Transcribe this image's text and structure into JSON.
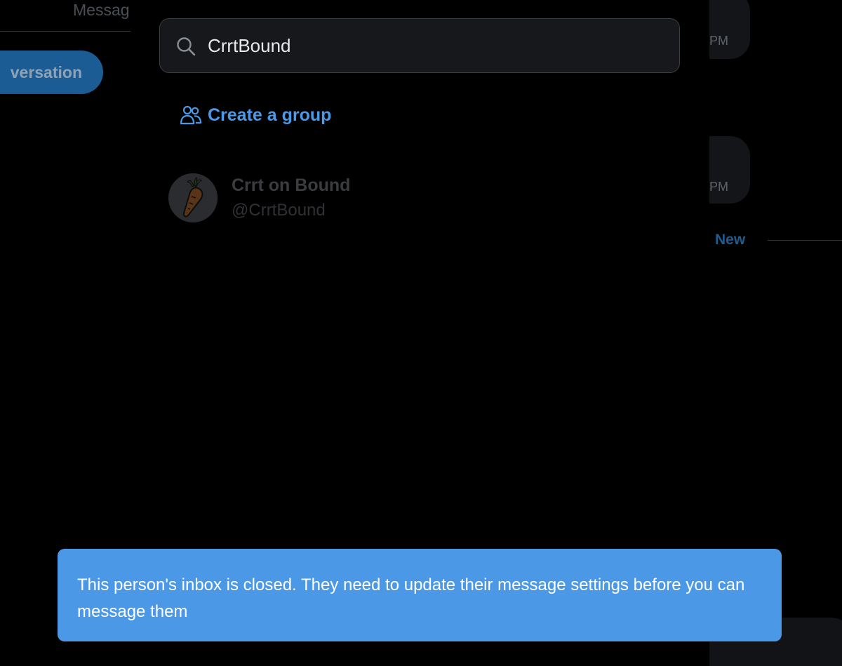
{
  "background": {
    "left_header_text": "Messag",
    "new_conversation_button_label": "versation",
    "message_times": [
      "PM",
      "PM"
    ],
    "new_divider_label": "New"
  },
  "search": {
    "value": "CrrtBound",
    "icon": "search-icon"
  },
  "create_group": {
    "label": "Create a group",
    "icon": "group-icon"
  },
  "results": [
    {
      "name": "Crrt on Bound",
      "handle": "@CrrtBound",
      "avatar": "carrot-avatar"
    }
  ],
  "toast": {
    "message": "This person's inbox is closed. They need to update their message settings before you can message them"
  },
  "colors": {
    "accent": "#4a9ae8",
    "toast_bg": "#4a98e6",
    "background": "#000000"
  }
}
